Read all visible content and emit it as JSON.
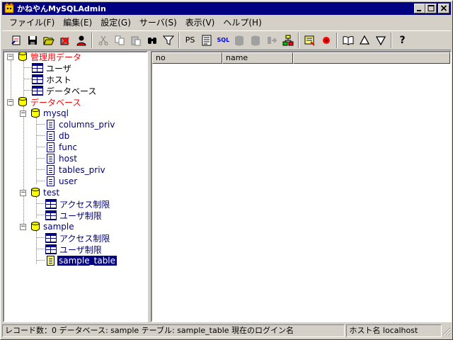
{
  "window": {
    "title": "かねやんMySQLAdmin",
    "minimize_label": "_",
    "maximize_label": "□",
    "close_label": "×"
  },
  "menubar": {
    "items": [
      {
        "label": "ファイル(F)"
      },
      {
        "label": "編集(E)"
      },
      {
        "label": "設定(G)"
      },
      {
        "label": "サーバ(S)"
      },
      {
        "label": "表示(V)"
      },
      {
        "label": "ヘルプ(H)"
      }
    ]
  },
  "toolbar": {
    "ps_label": "PS",
    "sql_label": "SQL",
    "help_label": "?"
  },
  "tree": {
    "nodes": [
      {
        "label": "管理用データ",
        "type": "db",
        "color": "red"
      },
      {
        "label": "ユーザ",
        "type": "table"
      },
      {
        "label": "ホスト",
        "type": "table"
      },
      {
        "label": "データベース",
        "type": "table"
      },
      {
        "label": "データベース",
        "type": "db",
        "color": "red"
      },
      {
        "label": "mysql",
        "type": "db"
      },
      {
        "label": "columns_priv",
        "type": "doc"
      },
      {
        "label": "db",
        "type": "doc"
      },
      {
        "label": "func",
        "type": "doc"
      },
      {
        "label": "host",
        "type": "doc"
      },
      {
        "label": "tables_priv",
        "type": "doc"
      },
      {
        "label": "user",
        "type": "doc"
      },
      {
        "label": "test",
        "type": "db"
      },
      {
        "label": "アクセス制限",
        "type": "table"
      },
      {
        "label": "ユーザ制限",
        "type": "table"
      },
      {
        "label": "sample",
        "type": "db"
      },
      {
        "label": "アクセス制限",
        "type": "table"
      },
      {
        "label": "ユーザ制限",
        "type": "table"
      },
      {
        "label": "sample_table",
        "type": "doc",
        "selected": true
      }
    ]
  },
  "grid": {
    "columns": [
      {
        "label": "no"
      },
      {
        "label": "name"
      }
    ]
  },
  "status": {
    "main": "レコード数：0  データベース: sample  テーブル: sample_table  現在のログイン名",
    "host": "ホスト名  localhost"
  },
  "colors": {
    "titlebar": "#000080",
    "face": "#d4d0c8",
    "selection": "#000080",
    "red_label": "#ff0000"
  }
}
